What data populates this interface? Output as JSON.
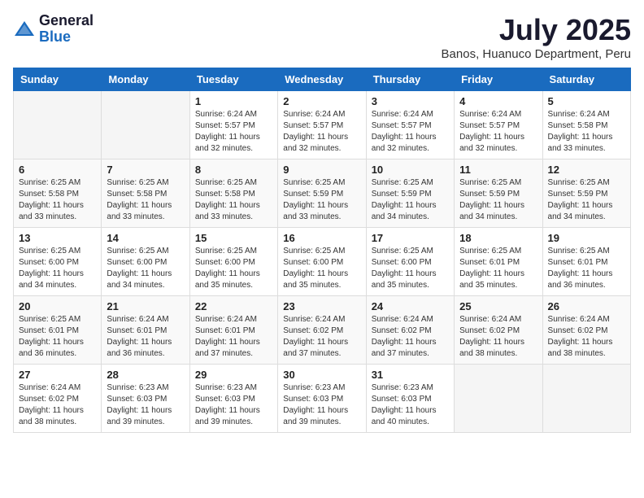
{
  "header": {
    "logo_general": "General",
    "logo_blue": "Blue",
    "title": "July 2025",
    "subtitle": "Banos, Huanuco Department, Peru"
  },
  "calendar": {
    "days_of_week": [
      "Sunday",
      "Monday",
      "Tuesday",
      "Wednesday",
      "Thursday",
      "Friday",
      "Saturday"
    ],
    "weeks": [
      [
        {
          "day": "",
          "info": ""
        },
        {
          "day": "",
          "info": ""
        },
        {
          "day": "1",
          "info": "Sunrise: 6:24 AM\nSunset: 5:57 PM\nDaylight: 11 hours and 32 minutes."
        },
        {
          "day": "2",
          "info": "Sunrise: 6:24 AM\nSunset: 5:57 PM\nDaylight: 11 hours and 32 minutes."
        },
        {
          "day": "3",
          "info": "Sunrise: 6:24 AM\nSunset: 5:57 PM\nDaylight: 11 hours and 32 minutes."
        },
        {
          "day": "4",
          "info": "Sunrise: 6:24 AM\nSunset: 5:57 PM\nDaylight: 11 hours and 32 minutes."
        },
        {
          "day": "5",
          "info": "Sunrise: 6:24 AM\nSunset: 5:58 PM\nDaylight: 11 hours and 33 minutes."
        }
      ],
      [
        {
          "day": "6",
          "info": "Sunrise: 6:25 AM\nSunset: 5:58 PM\nDaylight: 11 hours and 33 minutes."
        },
        {
          "day": "7",
          "info": "Sunrise: 6:25 AM\nSunset: 5:58 PM\nDaylight: 11 hours and 33 minutes."
        },
        {
          "day": "8",
          "info": "Sunrise: 6:25 AM\nSunset: 5:58 PM\nDaylight: 11 hours and 33 minutes."
        },
        {
          "day": "9",
          "info": "Sunrise: 6:25 AM\nSunset: 5:59 PM\nDaylight: 11 hours and 33 minutes."
        },
        {
          "day": "10",
          "info": "Sunrise: 6:25 AM\nSunset: 5:59 PM\nDaylight: 11 hours and 34 minutes."
        },
        {
          "day": "11",
          "info": "Sunrise: 6:25 AM\nSunset: 5:59 PM\nDaylight: 11 hours and 34 minutes."
        },
        {
          "day": "12",
          "info": "Sunrise: 6:25 AM\nSunset: 5:59 PM\nDaylight: 11 hours and 34 minutes."
        }
      ],
      [
        {
          "day": "13",
          "info": "Sunrise: 6:25 AM\nSunset: 6:00 PM\nDaylight: 11 hours and 34 minutes."
        },
        {
          "day": "14",
          "info": "Sunrise: 6:25 AM\nSunset: 6:00 PM\nDaylight: 11 hours and 34 minutes."
        },
        {
          "day": "15",
          "info": "Sunrise: 6:25 AM\nSunset: 6:00 PM\nDaylight: 11 hours and 35 minutes."
        },
        {
          "day": "16",
          "info": "Sunrise: 6:25 AM\nSunset: 6:00 PM\nDaylight: 11 hours and 35 minutes."
        },
        {
          "day": "17",
          "info": "Sunrise: 6:25 AM\nSunset: 6:00 PM\nDaylight: 11 hours and 35 minutes."
        },
        {
          "day": "18",
          "info": "Sunrise: 6:25 AM\nSunset: 6:01 PM\nDaylight: 11 hours and 35 minutes."
        },
        {
          "day": "19",
          "info": "Sunrise: 6:25 AM\nSunset: 6:01 PM\nDaylight: 11 hours and 36 minutes."
        }
      ],
      [
        {
          "day": "20",
          "info": "Sunrise: 6:25 AM\nSunset: 6:01 PM\nDaylight: 11 hours and 36 minutes."
        },
        {
          "day": "21",
          "info": "Sunrise: 6:24 AM\nSunset: 6:01 PM\nDaylight: 11 hours and 36 minutes."
        },
        {
          "day": "22",
          "info": "Sunrise: 6:24 AM\nSunset: 6:01 PM\nDaylight: 11 hours and 37 minutes."
        },
        {
          "day": "23",
          "info": "Sunrise: 6:24 AM\nSunset: 6:02 PM\nDaylight: 11 hours and 37 minutes."
        },
        {
          "day": "24",
          "info": "Sunrise: 6:24 AM\nSunset: 6:02 PM\nDaylight: 11 hours and 37 minutes."
        },
        {
          "day": "25",
          "info": "Sunrise: 6:24 AM\nSunset: 6:02 PM\nDaylight: 11 hours and 38 minutes."
        },
        {
          "day": "26",
          "info": "Sunrise: 6:24 AM\nSunset: 6:02 PM\nDaylight: 11 hours and 38 minutes."
        }
      ],
      [
        {
          "day": "27",
          "info": "Sunrise: 6:24 AM\nSunset: 6:02 PM\nDaylight: 11 hours and 38 minutes."
        },
        {
          "day": "28",
          "info": "Sunrise: 6:23 AM\nSunset: 6:03 PM\nDaylight: 11 hours and 39 minutes."
        },
        {
          "day": "29",
          "info": "Sunrise: 6:23 AM\nSunset: 6:03 PM\nDaylight: 11 hours and 39 minutes."
        },
        {
          "day": "30",
          "info": "Sunrise: 6:23 AM\nSunset: 6:03 PM\nDaylight: 11 hours and 39 minutes."
        },
        {
          "day": "31",
          "info": "Sunrise: 6:23 AM\nSunset: 6:03 PM\nDaylight: 11 hours and 40 minutes."
        },
        {
          "day": "",
          "info": ""
        },
        {
          "day": "",
          "info": ""
        }
      ]
    ]
  }
}
